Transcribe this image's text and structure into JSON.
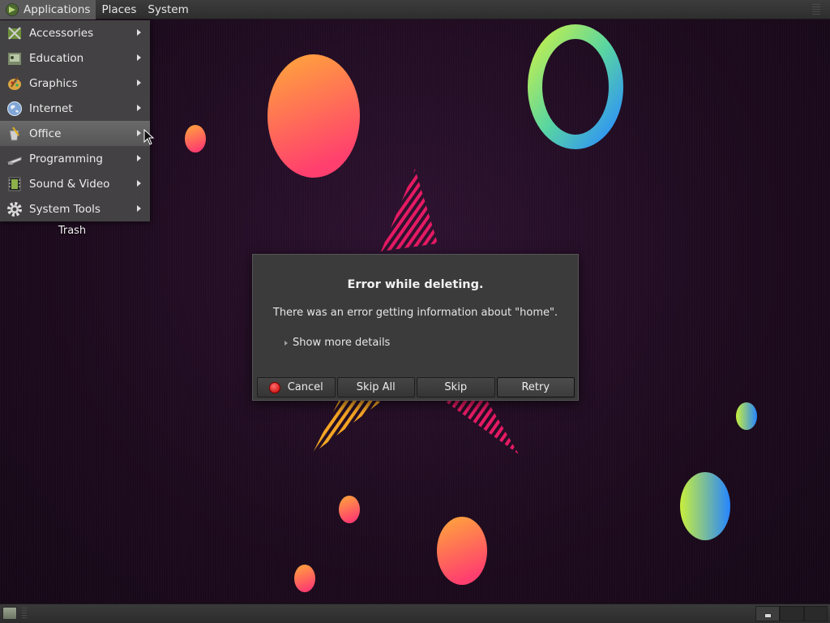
{
  "top_panel": {
    "menus": [
      {
        "label": "Applications",
        "icon": "mate-logo-icon"
      },
      {
        "label": "Places"
      },
      {
        "label": "System"
      }
    ]
  },
  "applications_menu": {
    "items": [
      {
        "label": "Accessories",
        "icon": "accessories-icon"
      },
      {
        "label": "Education",
        "icon": "education-icon"
      },
      {
        "label": "Graphics",
        "icon": "graphics-icon"
      },
      {
        "label": "Internet",
        "icon": "internet-globe-icon"
      },
      {
        "label": "Office",
        "icon": "office-icon",
        "highlighted": true
      },
      {
        "label": "Programming",
        "icon": "programming-icon"
      },
      {
        "label": "Sound & Video",
        "icon": "sound-video-icon"
      },
      {
        "label": "System Tools",
        "icon": "gear-icon"
      }
    ]
  },
  "desktop": {
    "icons": [
      {
        "label": "Trash",
        "icon": "trash-icon"
      }
    ]
  },
  "dialog": {
    "title": "Error while deleting.",
    "message": "There was an error getting information about \"home\".",
    "details_toggle": "Show more details",
    "buttons": {
      "cancel": "Cancel",
      "skip_all": "Skip All",
      "skip": "Skip",
      "retry": "Retry"
    }
  },
  "bottom_panel": {
    "workspaces": 3,
    "active_workspace": 1
  },
  "colors": {
    "wallpaper": "#1e0b1f",
    "panel": "#333333",
    "dialog": "#3b3b3b",
    "cancel_icon": "#d40000"
  }
}
